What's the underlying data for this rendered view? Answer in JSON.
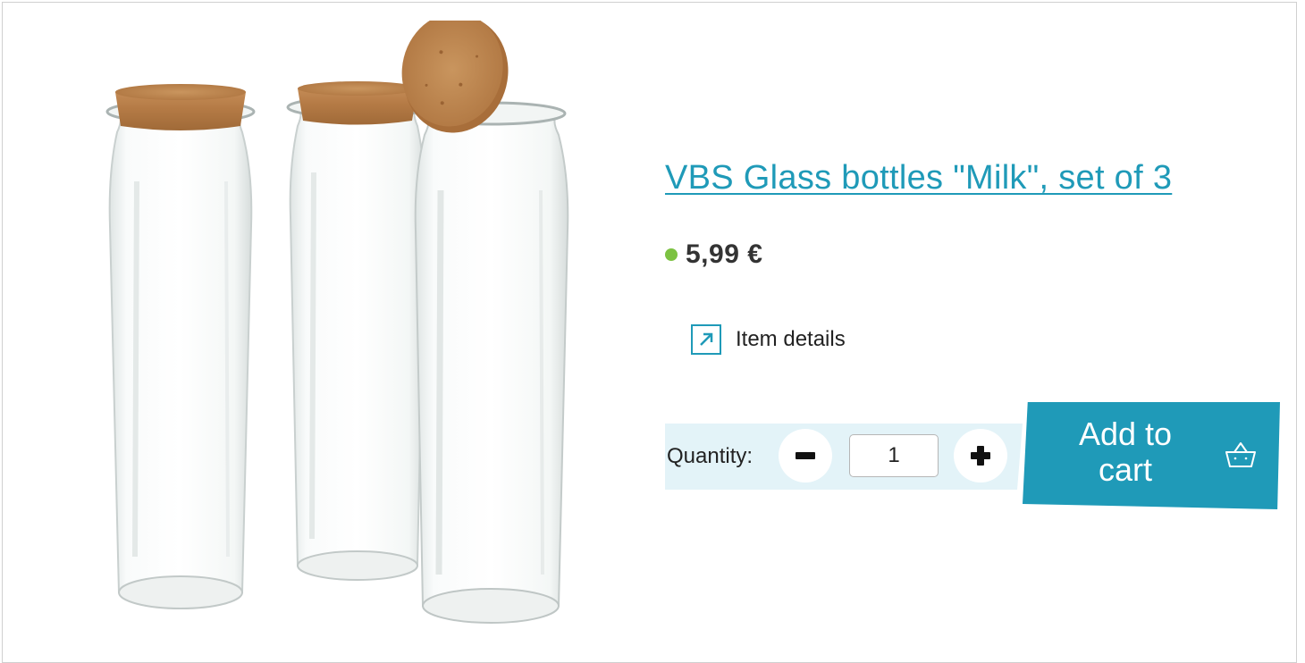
{
  "product": {
    "title": "VBS Glass bottles \"Milk\", set of 3",
    "price": "5,99 €",
    "stock_indicator_color": "#7cc242",
    "details_label": "Item details",
    "details_icon": "external-link-arrow-icon",
    "image_icon": "glass-bottles-with-cork-image"
  },
  "quantity": {
    "label": "Quantity:",
    "value": "1",
    "minus_icon": "minus-icon",
    "plus_icon": "plus-icon"
  },
  "cart": {
    "label_line1": "Add to",
    "label_line2": "cart",
    "icon": "basket-icon"
  },
  "colors": {
    "accent": "#1f9ab8",
    "quantity_background": "#e3f3f8",
    "in_stock": "#7cc242"
  }
}
